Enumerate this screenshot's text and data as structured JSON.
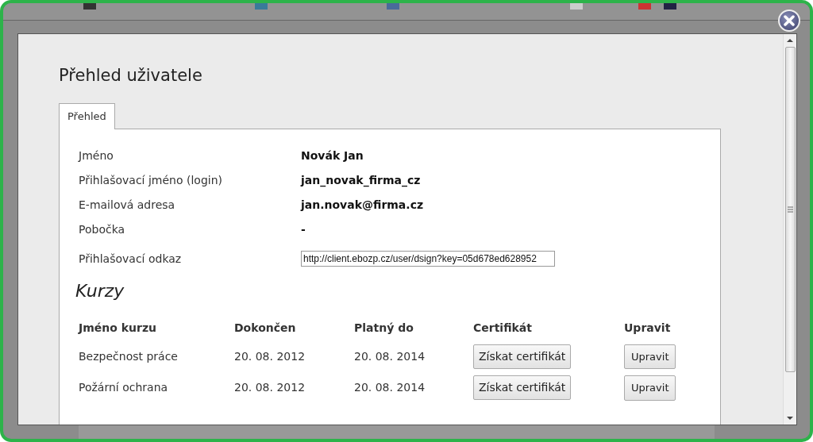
{
  "title": "Přehled uživatele",
  "tabs": [
    {
      "label": "Přehled",
      "selected": true
    }
  ],
  "fields": [
    {
      "label": "Jméno",
      "value": "Novák Jan",
      "kind": "text"
    },
    {
      "label": "Přihlašovací jméno (login)",
      "value": "jan_novak_firma_cz",
      "kind": "text"
    },
    {
      "label": "E-mailová adresa",
      "value": "jan.novak@firma.cz",
      "kind": "text"
    },
    {
      "label": "Pobočka",
      "value": "-",
      "kind": "text"
    },
    {
      "label": "Přihlašovací odkaz",
      "value": "http://client.ebozp.cz/user/dsign?key=05d678ed628952",
      "kind": "input"
    }
  ],
  "courses_heading": "Kurzy",
  "table": {
    "columns": [
      "Jméno kurzu",
      "Dokončen",
      "Platný do",
      "Certifikát",
      "Upravit"
    ],
    "rows": [
      {
        "name": "Bezpečnost práce",
        "completed": "20. 08. 2012",
        "valid_until": "20. 08. 2014",
        "certificate_button": "Získat certifikát",
        "edit_button": "Upravit"
      },
      {
        "name": "Požární ochrana",
        "completed": "20. 08. 2012",
        "valid_until": "20. 08. 2014",
        "certificate_button": "Získat certifikát",
        "edit_button": "Upravit"
      }
    ]
  }
}
